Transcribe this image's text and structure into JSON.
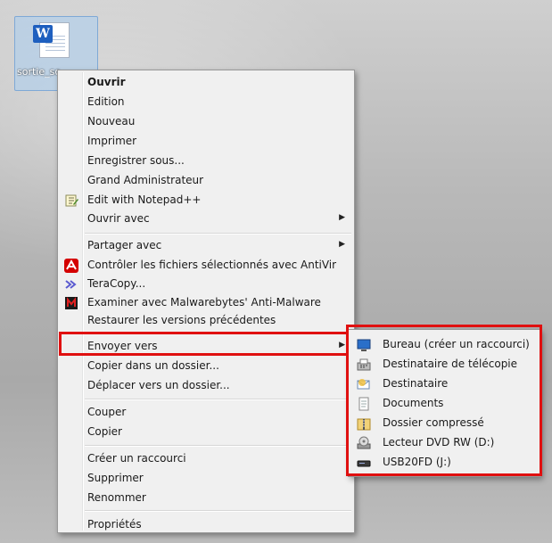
{
  "desktop": {
    "file_label": "sortie_sc",
    "file_icon_letter": "W"
  },
  "context_menu": {
    "items": [
      {
        "label": "Ouvrir"
      },
      {
        "label": "Edition"
      },
      {
        "label": "Nouveau"
      },
      {
        "label": "Imprimer"
      },
      {
        "label": "Enregistrer sous..."
      },
      {
        "label": "Grand Administrateur"
      },
      {
        "label": "Edit with Notepad++"
      },
      {
        "label": "Ouvrir avec"
      },
      {
        "label": "Partager avec"
      },
      {
        "label": "Contrôler les fichiers sélectionnés avec AntiVir"
      },
      {
        "label": "TeraCopy..."
      },
      {
        "label": "Examiner avec Malwarebytes' Anti-Malware"
      },
      {
        "label": "Restaurer les versions précédentes"
      },
      {
        "label": "Envoyer vers"
      },
      {
        "label": "Copier dans un dossier..."
      },
      {
        "label": "Déplacer vers un dossier..."
      },
      {
        "label": "Couper"
      },
      {
        "label": "Copier"
      },
      {
        "label": "Créer un raccourci"
      },
      {
        "label": "Supprimer"
      },
      {
        "label": "Renommer"
      },
      {
        "label": "Propriétés"
      }
    ],
    "arrow_glyph": "▶"
  },
  "send_to_menu": {
    "items": [
      {
        "label": "Bureau (créer un raccourci)",
        "icon": "desktop-icon"
      },
      {
        "label": "Destinataire de télécopie",
        "icon": "fax-icon"
      },
      {
        "label": "Destinataire",
        "icon": "mail-recipient-icon"
      },
      {
        "label": "Documents",
        "icon": "documents-icon"
      },
      {
        "label": "Dossier compressé",
        "icon": "zip-folder-icon"
      },
      {
        "label": "Lecteur DVD RW (D:)",
        "icon": "dvd-drive-icon"
      },
      {
        "label": "USB20FD (J:)",
        "icon": "usb-drive-icon"
      }
    ]
  },
  "colors": {
    "highlight_border": "#e01010",
    "menu_bg": "#f0f0f0"
  }
}
